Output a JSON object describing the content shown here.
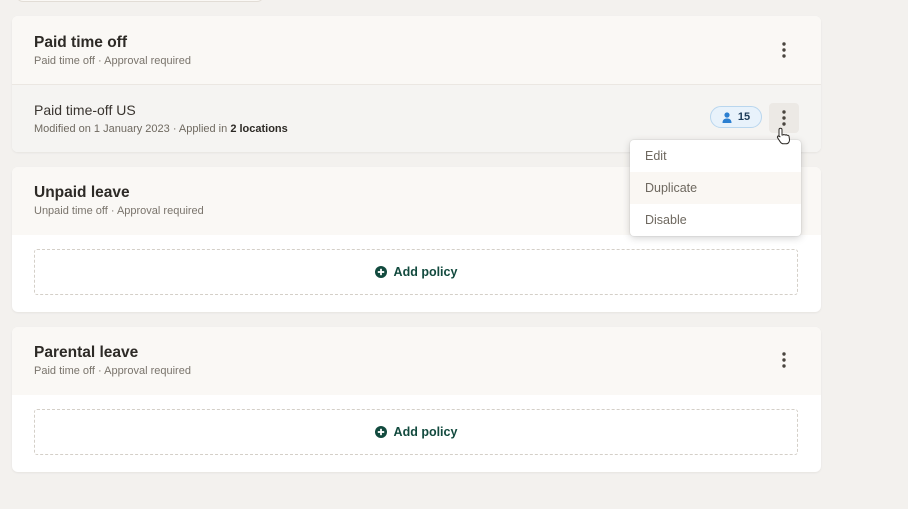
{
  "sections": [
    {
      "title": "Paid time off",
      "subtitle": "Paid time off · Approval required",
      "policy": {
        "name": "Paid time-off US",
        "meta_prefix": "Modified on 1 January 2023 · Applied in ",
        "locations": "2 locations",
        "badge_count": "15"
      }
    },
    {
      "title": "Unpaid leave",
      "subtitle": "Unpaid time off · Approval required",
      "add_label": "Add policy"
    },
    {
      "title": "Parental leave",
      "subtitle": "Paid time off · Approval required",
      "add_label": "Add policy"
    }
  ],
  "menu": {
    "items": [
      "Edit",
      "Duplicate",
      "Disable"
    ]
  },
  "colors": {
    "background": "#f3f1ee",
    "card_header": "#faf8f5",
    "accent_green": "#124a3e",
    "badge_blue": "#2b7fd1"
  },
  "icons": {
    "more": "kebab-vertical",
    "person": "user",
    "add": "plus-circle",
    "cursor": "hand-pointer"
  }
}
